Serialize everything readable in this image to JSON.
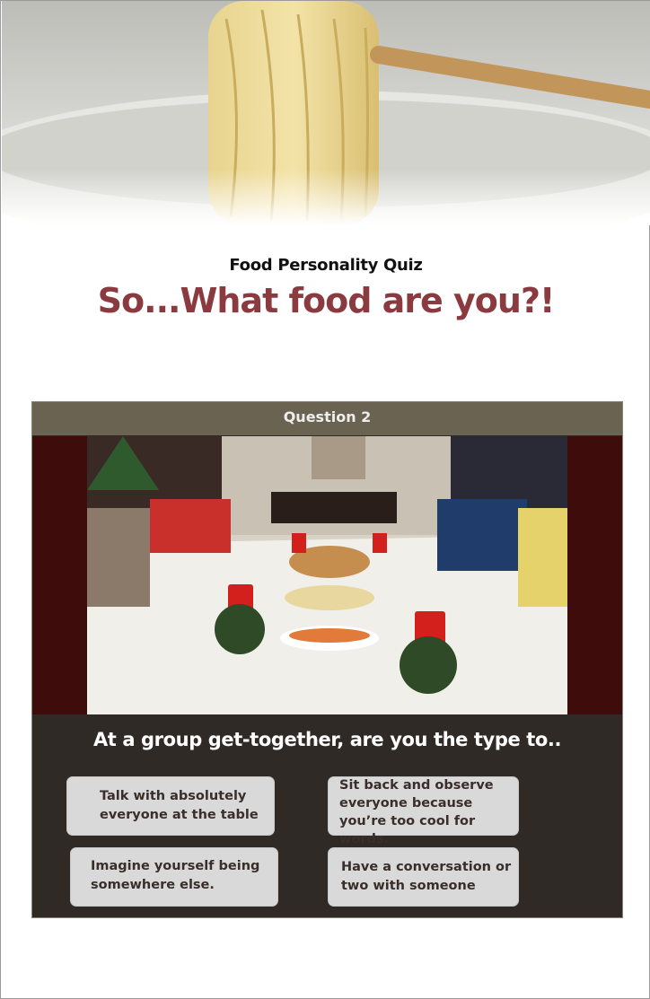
{
  "header": {
    "image_description_icon": "noodles-photo",
    "subtitle": "Food Personality Quiz",
    "title": "So...What food are you?!"
  },
  "question": {
    "label": "Question 2",
    "image_icon": "dogs-dinner-party-photo",
    "text": "At a group get-together, are you the type to..",
    "answers": [
      "Talk with absolutely everyone at the table",
      "Sit back and observe everyone because you’re too cool for words.",
      "Imagine yourself being somewhere else.",
      "Have a conversation or two with someone"
    ]
  },
  "colors": {
    "title": "#8b3a3f",
    "card_background": "#2f2a26",
    "header_bar": "#6b6351",
    "image_band": "#3e0c0b",
    "answer_background": "#d9d9d9"
  }
}
